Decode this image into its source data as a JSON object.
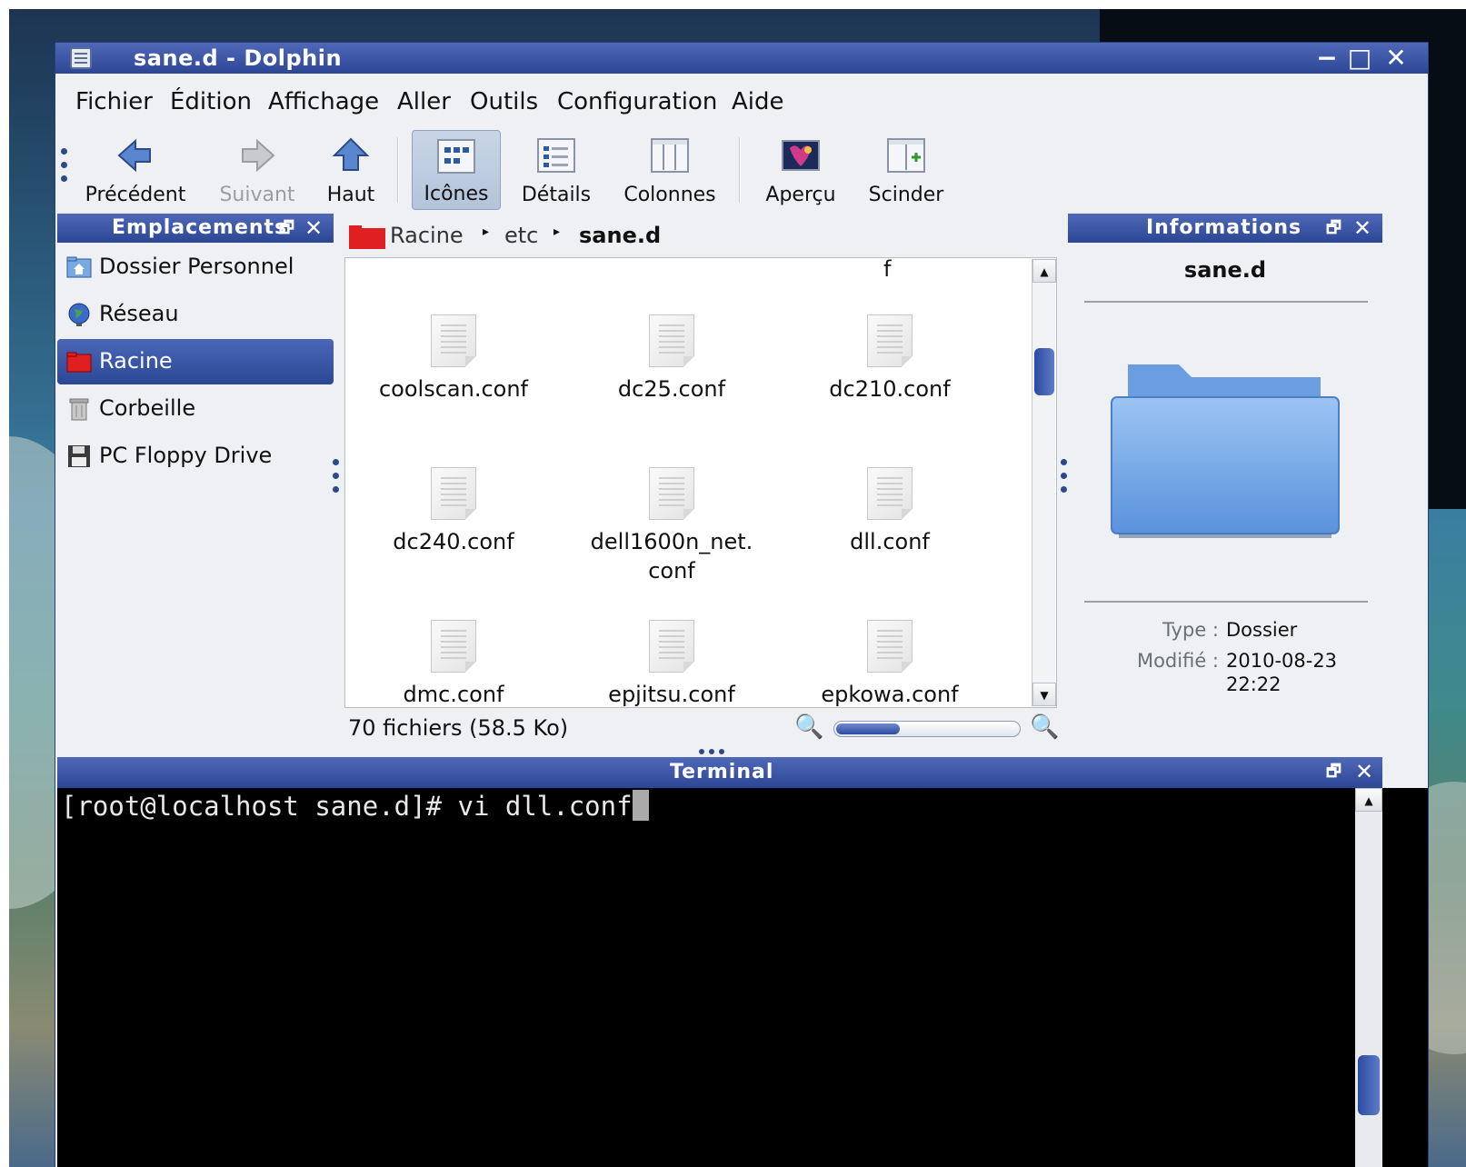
{
  "window": {
    "title": "sane.d - Dolphin",
    "controls": {
      "minimize": "−",
      "maximize": "□",
      "close": "✕"
    }
  },
  "menubar": [
    "Fichier",
    "Édition",
    "Affichage",
    "Aller",
    "Outils",
    "Configuration",
    "Aide"
  ],
  "toolbar": {
    "back": "Précédent",
    "forward": "Suivant",
    "up": "Haut",
    "icons": "Icônes",
    "details": "Détails",
    "columns": "Colonnes",
    "preview": "Aperçu",
    "split": "Scinder",
    "active_view": "Icônes"
  },
  "places": {
    "title": "Emplacements",
    "items": [
      {
        "label": "Dossier Personnel",
        "icon": "home-folder-icon"
      },
      {
        "label": "Réseau",
        "icon": "network-globe-icon"
      },
      {
        "label": "Racine",
        "icon": "root-folder-icon",
        "selected": true
      },
      {
        "label": "Corbeille",
        "icon": "trash-icon"
      },
      {
        "label": "PC Floppy Drive",
        "icon": "floppy-icon"
      }
    ]
  },
  "breadcrumb": {
    "items": [
      "Racine",
      "etc",
      "sane.d"
    ]
  },
  "files": {
    "top_partial": "f",
    "items": [
      "coolscan.conf",
      "dc25.conf",
      "dc210.conf",
      "dc240.conf",
      "dell1600n_net.\nconf",
      "dll.conf",
      "dmc.conf",
      "epjitsu.conf",
      "epkowa.conf"
    ]
  },
  "status": {
    "text": "70 fichiers (58.5 Ko)",
    "zoom_fraction": 0.35
  },
  "info": {
    "title": "Informations",
    "name": "sane.d",
    "type_label": "Type :",
    "type_value": "Dossier",
    "modified_label": "Modifié :",
    "modified_value": "2010-08-23",
    "modified_time": "22:22"
  },
  "terminal": {
    "title": "Terminal",
    "prompt": "[root@localhost sane.d]# vi dll.conf"
  },
  "colors": {
    "titlebar": "#2c4696",
    "accent": "#4f68b8",
    "window_bg": "#eef0f3",
    "terminal_bg": "#000000"
  }
}
